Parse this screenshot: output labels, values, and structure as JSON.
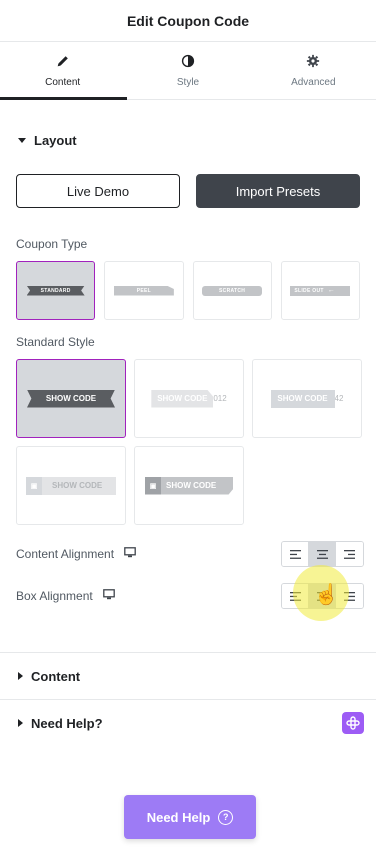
{
  "header": {
    "title": "Edit Coupon Code"
  },
  "tabs": [
    {
      "label": "Content",
      "icon": "pencil-icon"
    },
    {
      "label": "Style",
      "icon": "half-circle-icon"
    },
    {
      "label": "Advanced",
      "icon": "gear-icon"
    }
  ],
  "layout_section": {
    "title": "Layout",
    "live_demo": "Live Demo",
    "import_presets": "Import Presets",
    "coupon_type_label": "Coupon Type",
    "coupon_types": [
      "STANDARD",
      "PEEL",
      "SCRATCH",
      "SLIDE OUT"
    ],
    "standard_style_label": "Standard Style",
    "standard_styles": [
      "SHOW CODE",
      "SHOW CODE",
      "SHOW CODE",
      "SHOW CODE",
      "SHOW CODE"
    ],
    "style_code_suffixes": [
      "",
      "012",
      "42",
      "",
      ""
    ],
    "content_alignment_label": "Content Alignment",
    "box_alignment_label": "Box Alignment"
  },
  "content_section": {
    "title": "Content"
  },
  "help_section": {
    "title": "Need Help?"
  },
  "help_button": {
    "label": "Need Help",
    "icon_glyph": "?"
  },
  "colors": {
    "accent": "#a122bd",
    "help": "#9d7bf5",
    "dark": "#3f444b"
  }
}
